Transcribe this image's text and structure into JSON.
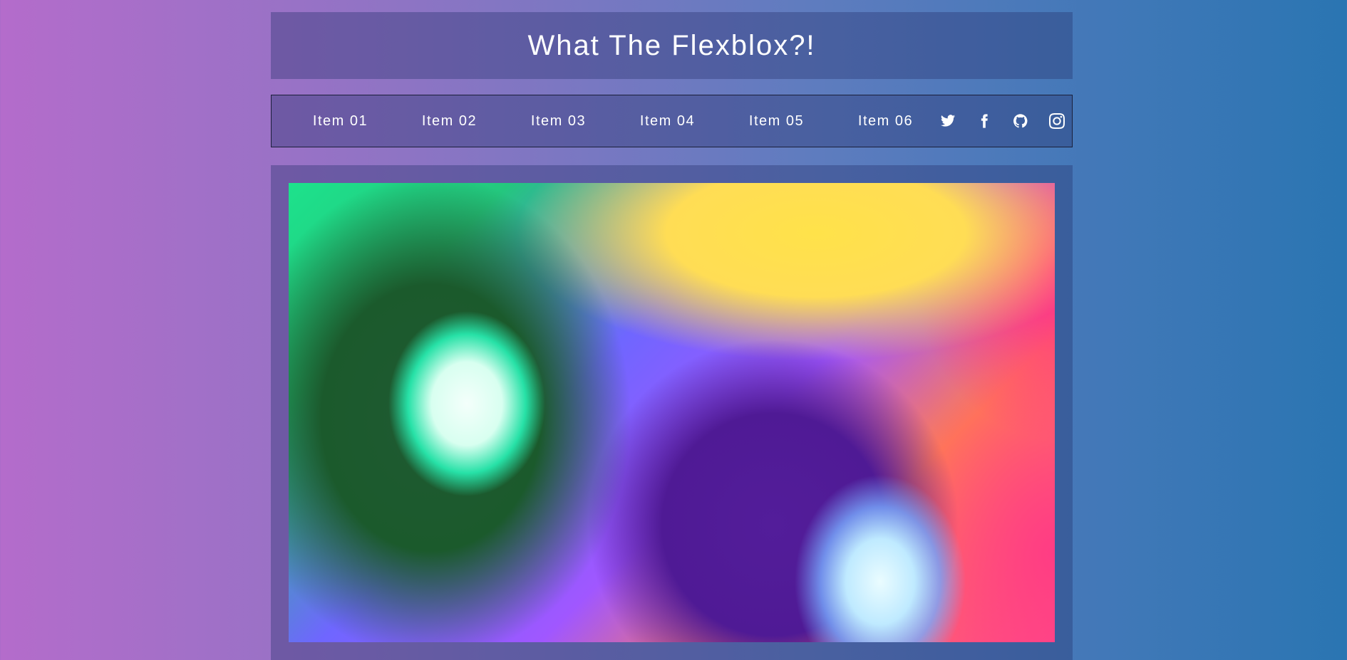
{
  "header": {
    "title": "What The Flexblox?!"
  },
  "nav": {
    "items": [
      {
        "label": "Item 01"
      },
      {
        "label": "Item 02"
      },
      {
        "label": "Item 03"
      },
      {
        "label": "Item 04"
      },
      {
        "label": "Item 05"
      },
      {
        "label": "Item 06"
      }
    ],
    "social": [
      {
        "icon": "twitter-icon"
      },
      {
        "icon": "facebook-icon"
      },
      {
        "icon": "github-icon"
      },
      {
        "icon": "instagram-icon"
      }
    ]
  },
  "colors": {
    "background_left": "#b46ccb",
    "background_right": "#2a75b2",
    "text": "#ffffff"
  }
}
